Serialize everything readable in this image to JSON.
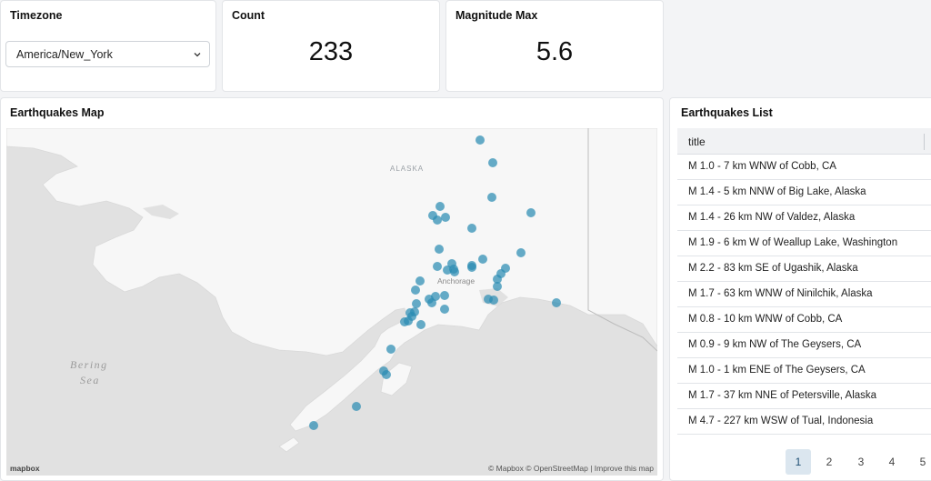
{
  "timezone": {
    "title": "Timezone",
    "selected": "America/New_York"
  },
  "count": {
    "title": "Count",
    "value": "233"
  },
  "magnitude": {
    "title": "Magnitude Max",
    "value": "5.6"
  },
  "map": {
    "title": "Earthquakes Map",
    "labels": {
      "region": "ALASKA",
      "sea_line1": "Bering",
      "sea_line2": "Sea",
      "city": "Anchorage"
    },
    "attribution": "© Mapbox  © OpenStreetMap  |  Improve this map",
    "logo": "mapbox",
    "marker_color": "#2b8cb3"
  },
  "list": {
    "title": "Earthquakes List",
    "column": "title",
    "rows": [
      "M 1.0 - 7 km WNW of Cobb, CA",
      "M 1.4 - 5 km NNW of Big Lake, Alaska",
      "M 1.4 - 26 km NW of Valdez, Alaska",
      "M 1.9 - 6 km W of Weallup Lake, Washington",
      "M 2.2 - 83 km SE of Ugashik, Alaska",
      "M 1.7 - 63 km WNW of Ninilchik, Alaska",
      "M 0.8 - 10 km WNW of Cobb, CA",
      "M 0.9 - 9 km NW of The Geysers, CA",
      "M 1.0 - 1 km ENE of The Geysers, CA",
      "M 1.7 - 37 km NNE of Petersville, Alaska",
      "M 4.7 - 227 km WSW of Tual, Indonesia"
    ],
    "pages": [
      "1",
      "2",
      "3",
      "4",
      "5"
    ],
    "active_page": "1"
  }
}
